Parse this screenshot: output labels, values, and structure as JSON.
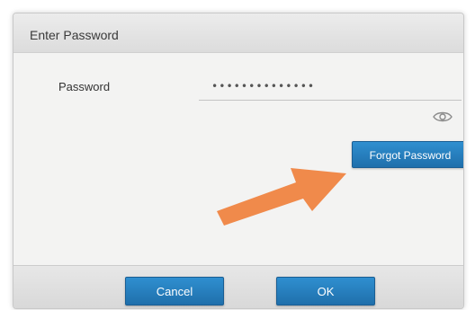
{
  "dialog": {
    "title": "Enter Password",
    "password_label": "Password",
    "password_value": "••••••••••••••",
    "forgot_label": "Forgot Password",
    "cancel_label": "Cancel",
    "ok_label": "OK"
  },
  "icons": {
    "visibility": "eye-icon",
    "annotation": "arrow-icon"
  },
  "colors": {
    "button_blue": "#1f6fab",
    "arrow_orange": "#f08a4b"
  }
}
